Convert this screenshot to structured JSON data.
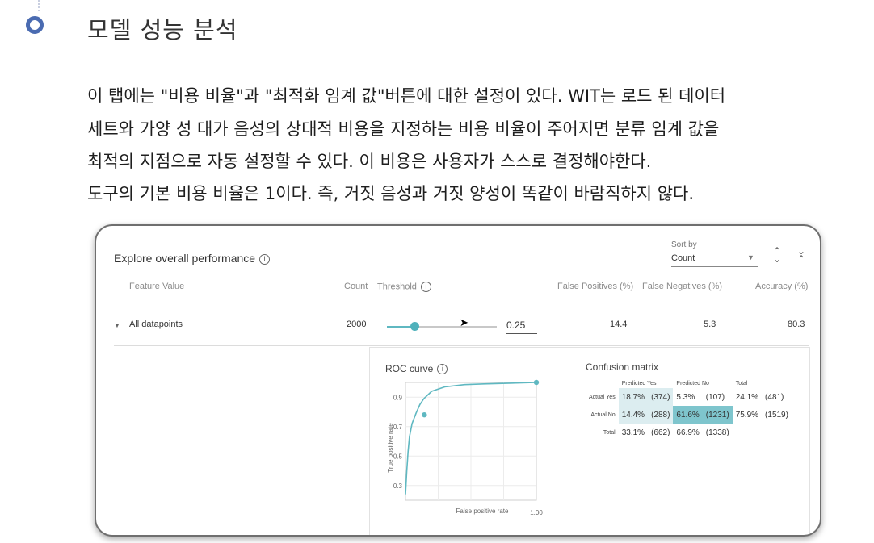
{
  "section": {
    "heading": "모델 성능 분석"
  },
  "paragraph": [
    "이 탭에는 \"비용 비율\"과 \"최적화 임계 값\"버튼에 대한 설정이 있다. WIT는 로드 된 데이터",
    "세트와 가양 성 대가 음성의 상대적 비용을 지정하는 비용 비율이 주어지면 분류 임계 값을",
    "최적의 지점으로 자동 설정할 수 있다. 이 비용은 사용자가 스스로 결정해야한다.",
    "도구의 기본 비용 비율은 1이다. 즉, 거짓 음성과 거짓 양성이 똑같이 바람직하지 않다."
  ],
  "panel": {
    "title": "Explore overall performance",
    "sort_by_label": "Sort by",
    "sort_by_value": "Count",
    "columns": {
      "feature_value": "Feature Value",
      "count": "Count",
      "threshold": "Threshold",
      "false_positives": "False Positives (%)",
      "false_negatives": "False Negatives (%)",
      "accuracy": "Accuracy (%)"
    },
    "row": {
      "label": "All datapoints",
      "count": "2000",
      "threshold": "0.25",
      "threshold_fraction": 0.25,
      "false_positives": "14.4",
      "false_negatives": "5.3",
      "accuracy": "80.3"
    },
    "roc_title": "ROC curve",
    "cm_title": "Confusion matrix",
    "confusion_matrix": {
      "col_headers": [
        "Predicted Yes",
        "Predicted No",
        "Total"
      ],
      "rows": [
        {
          "label": "Actual Yes",
          "cells": [
            "18.7%",
            "(374)",
            "5.3%",
            "(107)",
            "24.1%",
            "(481)"
          ]
        },
        {
          "label": "Actual No",
          "cells": [
            "14.4%",
            "(288)",
            "61.6%",
            "(1231)",
            "75.9%",
            "(1519)"
          ]
        },
        {
          "label": "Total",
          "cells": [
            "33.1%",
            "(662)",
            "66.9%",
            "(1338)",
            "",
            ""
          ]
        }
      ]
    }
  },
  "chart_data": {
    "type": "line",
    "title": "ROC curve",
    "xlabel": "False positive rate",
    "ylabel": "True positive rate",
    "x_tick_labels": [
      "1.00"
    ],
    "y_tick_labels": [
      "0.3",
      "0.5",
      "0.7",
      "0.9"
    ],
    "xlim": [
      0,
      1
    ],
    "ylim": [
      0.2,
      1.0
    ],
    "grid": true,
    "series": [
      {
        "x": [
          0.0,
          0.01,
          0.02,
          0.03,
          0.05,
          0.08,
          0.11,
          0.14,
          0.2,
          0.3,
          0.45,
          0.6,
          0.8,
          1.0
        ],
        "y": [
          0.24,
          0.4,
          0.53,
          0.63,
          0.72,
          0.79,
          0.85,
          0.89,
          0.94,
          0.97,
          0.985,
          0.99,
          0.995,
          1.0
        ]
      }
    ],
    "highlight_points": [
      {
        "x": 0.144,
        "y": 0.78
      },
      {
        "x": 1.0,
        "y": 1.0
      }
    ],
    "color": "#5fb8c1"
  }
}
